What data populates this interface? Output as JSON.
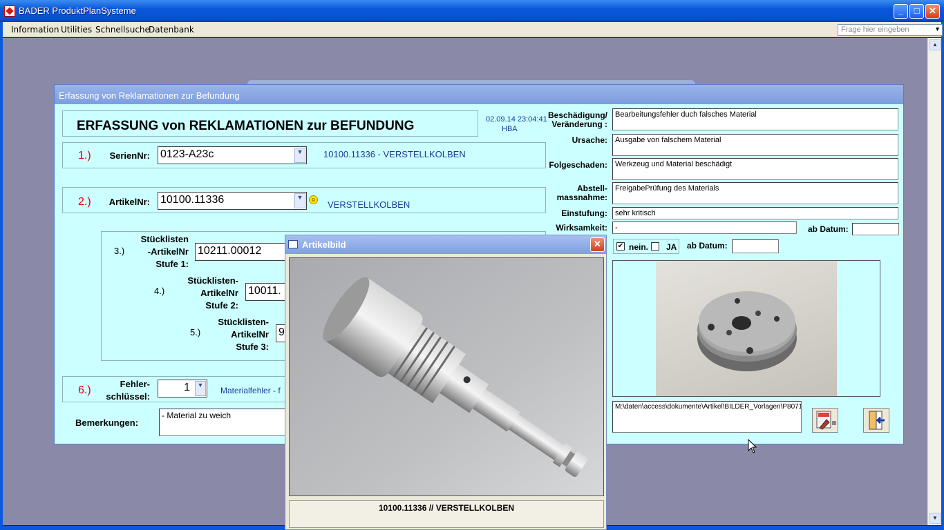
{
  "window": {
    "title": "BADER ProduktPlanSysteme"
  },
  "menu": {
    "items": [
      "Information",
      "Utilities",
      "Schnellsuche",
      "Datenbank"
    ],
    "help_placeholder": "Frage hier eingeben"
  },
  "form": {
    "window_title": "Erfassung von Reklamationen zur Befundung",
    "heading": "ERFASSUNG von REKLAMATIONEN zur BEFUNDUNG",
    "timestamp": "02.09.14 23:04:41",
    "user": "HBA",
    "serial": {
      "num": "1.)",
      "label": "SerienNr:",
      "value": "0123-A23c",
      "info": "10100.11336 - VERSTELLKOLBEN"
    },
    "article": {
      "num": "2.)",
      "label": "ArtikelNr:",
      "value": "10100.11336",
      "info": "VERSTELLKOLBEN"
    },
    "bom1": {
      "num": "3.)",
      "label1": "Stücklisten",
      "label2": "-ArtikelNr",
      "label3": "Stufe 1:",
      "value": "10211.00012"
    },
    "bom2": {
      "num": "4.)",
      "label1": "Stücklisten-",
      "label2": "ArtikelNr",
      "label3": "Stufe 2:",
      "value": "10011."
    },
    "bom3": {
      "num": "5.)",
      "label1": "Stücklisten-",
      "label2": "ArtikelNr",
      "label3": "Stufe 3:",
      "value": "9"
    },
    "fault": {
      "num": "6.)",
      "label1": "Fehler-",
      "label2": "schlüssel:",
      "value": "1",
      "info": "Materialfehler - f"
    },
    "remarks": {
      "label": "Bemerkungen:",
      "value": "- Material zu weich"
    },
    "damage": {
      "label1": "Beschädigung/",
      "label2": "Veränderung :",
      "value": "Bearbeitungsfehler duch falsches Material"
    },
    "cause": {
      "label": "Ursache:",
      "value": "Ausgabe von falschem Material"
    },
    "consequence": {
      "label": "Folgeschaden:",
      "value": "Werkzeug und Material beschädigt"
    },
    "remedy": {
      "label1": "Abstell-",
      "label2": "massnahme:",
      "value": "FreigabePrüfung des Materials"
    },
    "rating": {
      "label": "Einstufung:",
      "value": "sehr kritisch"
    },
    "effectiveness": {
      "label": "Wirksamkeit:",
      "value": "-",
      "date_label": "ab Datum:",
      "date_value": ""
    },
    "check": {
      "nein_label": "nein.",
      "ja_label": "JA",
      "nein_checked": true,
      "ja_checked": false,
      "date_label": "ab Datum:",
      "date_value": ""
    },
    "image_path": "M:\\daten\\access\\dokumente\\Artikel\\BILDER_Vorlagen\\P8071040_Ausgleichscheibe_small.JPG"
  },
  "dialog": {
    "title": "Artikelbild",
    "caption": "10100.11336  //  VERSTELLKOLBEN"
  },
  "colors": {
    "form_bg": "#ccffff",
    "accent_red": "#e00000",
    "info_blue": "#1a3a9a"
  }
}
